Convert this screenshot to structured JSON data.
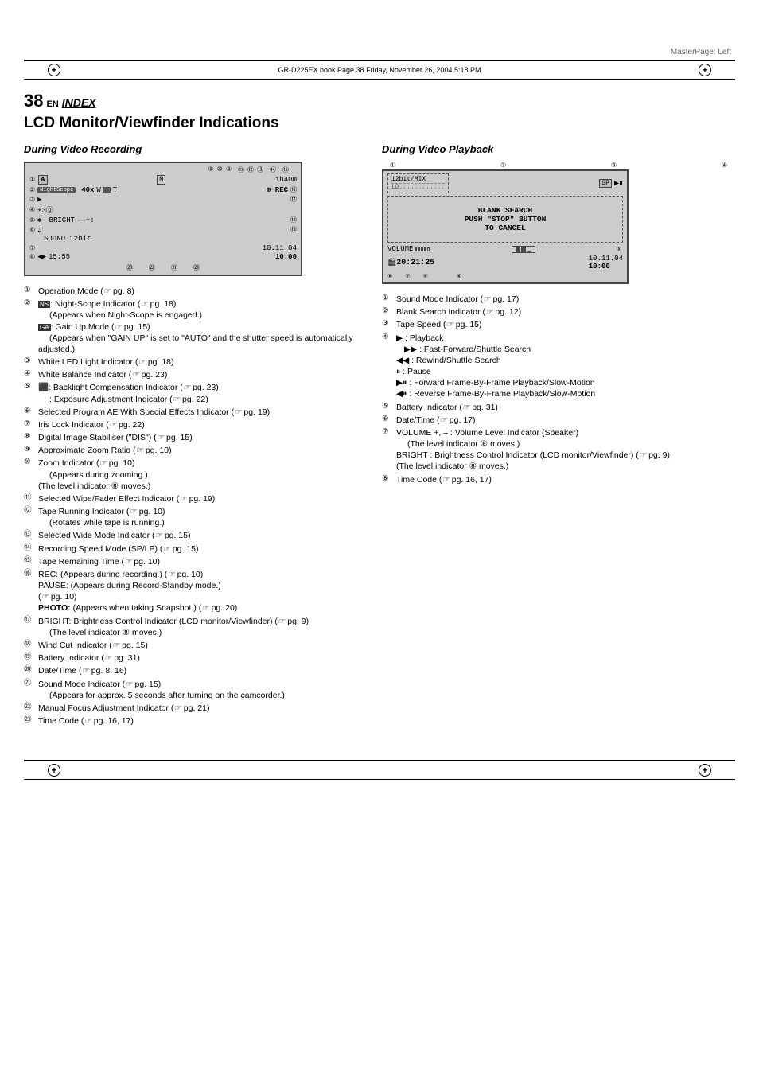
{
  "page": {
    "master_page_label": "MasterPage: Left",
    "book_ref": "GR-D225EX.book  Page 38  Friday, November 26, 2004  5:18 PM",
    "page_number": "38",
    "en_label": "EN",
    "index_label": "INDEX",
    "page_title": "LCD Monitor/Viewfinder Indications",
    "left_section_title": "During Video Recording",
    "right_section_title": "During Video Playback"
  },
  "recording_diagram": {
    "row1": "⑨ ⑩ ⑧  ⑪⑫⑬  ⑭  ⑮",
    "row2": "① A         M̈    1h40m",
    "row3": "②  40x W■■T",
    "row4": "③ ▶",
    "row5": "④ ±3⓪",
    "row6": "⑤ ✱         BRIGHT ——+:    ⑱",
    "row7": "⑥ 🎵                        ⑲",
    "row8": "    SOUND 12bit",
    "row9": "⑦                10.11.04",
    "row10": "⑧ ◀▶15:55         10:00",
    "row11": "         ⑳  ㉒ ㉑  ㉓"
  },
  "recording_items": [
    {
      "num": "①",
      "text": "Operation Mode (",
      "pg": "pg. 8",
      "suffix": ")"
    },
    {
      "num": "②",
      "text": ": Night-Scope Indicator (",
      "pg": "pg. 18",
      "suffix": ")",
      "extra": "(Appears when Night-Scope is engaged.)"
    },
    {
      "num": "",
      "text": ": Gain Up Mode (",
      "pg": "pg. 15",
      "suffix": ")",
      "extra": "(Appears when \"GAIN UP\" is set to \"AUTO\" and the shutter speed is automatically adjusted.)"
    },
    {
      "num": "③",
      "text": "White LED Light Indicator (",
      "pg": "pg. 18",
      "suffix": ")"
    },
    {
      "num": "④",
      "text": "White Balance Indicator (",
      "pg": "pg. 23",
      "suffix": ")"
    },
    {
      "num": "⑤",
      "text": ": Backlight Compensation Indicator (",
      "pg": "pg. 23",
      "suffix": ")"
    },
    {
      "num": "",
      "text": ": Exposure Adjustment Indicator (",
      "pg": "pg. 22",
      "suffix": ")"
    },
    {
      "num": "⑥",
      "text": "Selected Program AE With Special Effects Indicator (",
      "pg": "pg. 19",
      "suffix": ")"
    },
    {
      "num": "⑦",
      "text": "Iris Lock Indicator (",
      "pg": "pg. 22",
      "suffix": ")"
    },
    {
      "num": "⑧",
      "text": "Digital Image Stabiliser (\"DIS\") (",
      "pg": "pg. 15",
      "suffix": ")"
    },
    {
      "num": "⑨",
      "text": "Approximate Zoom Ratio (",
      "pg": "pg. 10",
      "suffix": ")"
    },
    {
      "num": "⑩",
      "text": "Zoom Indicator (",
      "pg": "pg. 10",
      "suffix": ")",
      "extra": "(Appears during zooming.)\n(The level indicator ⑧ moves.)"
    },
    {
      "num": "⑪",
      "text": "Selected Wipe/Fader Effect Indicator (",
      "pg": "pg. 19",
      "suffix": ")"
    },
    {
      "num": "⑫",
      "text": "Tape Running Indicator (",
      "pg": "pg. 10",
      "suffix": ")",
      "extra": "(Rotates while tape is running.)"
    },
    {
      "num": "⑬",
      "text": "Selected Wide Mode Indicator (",
      "pg": "pg. 15",
      "suffix": ")"
    },
    {
      "num": "⑭",
      "text": "Recording Speed Mode (SP/LP) (",
      "pg": "pg. 15",
      "suffix": ")"
    },
    {
      "num": "⑮",
      "text": "Tape Remaining Time (",
      "pg": "pg. 10",
      "suffix": ")"
    },
    {
      "num": "⑯",
      "text": "REC: (Appears during recording.) (",
      "pg": "pg. 10",
      "suffix": ")",
      "extra": "PAUSE: (Appears during Record-Standby mode.)\n(pg. 10)\nPHOTO: (Appears when taking Snapshot.) (pg. 20)"
    },
    {
      "num": "⑰",
      "text": "BRIGHT: Brightness Control Indicator (LCD monitor/Viewfinder) (",
      "pg": "pg. 9",
      "suffix": ")",
      "extra": "(The level indicator ⑧ moves.)"
    },
    {
      "num": "⑱",
      "text": "Wind Cut Indicator (",
      "pg": "pg. 15",
      "suffix": ")"
    },
    {
      "num": "⑲",
      "text": "Battery Indicator (",
      "pg": "pg. 31",
      "suffix": ")"
    },
    {
      "num": "⑳",
      "text": "Date/Time (",
      "pg": "pg. 8, 16",
      "suffix": ")"
    },
    {
      "num": "㉑",
      "text": "Sound Mode Indicator (",
      "pg": "pg. 15",
      "suffix": ")",
      "extra": "(Appears for approx. 5 seconds after turning on the camcorder.)"
    },
    {
      "num": "㉒",
      "text": "Manual Focus Adjustment Indicator (",
      "pg": "pg. 21",
      "suffix": ")"
    },
    {
      "num": "㉓",
      "text": "Time Code (",
      "pg": "pg. 16, 17",
      "suffix": ")"
    }
  ],
  "playback_items": [
    {
      "num": "①",
      "text": "Sound Mode Indicator (",
      "pg": "pg. 17",
      "suffix": ")"
    },
    {
      "num": "②",
      "text": "Blank Search Indicator (",
      "pg": "pg. 12",
      "suffix": ")"
    },
    {
      "num": "③",
      "text": "Tape Speed (",
      "pg": "pg. 15",
      "suffix": ")"
    },
    {
      "num": "④",
      "text": "▶ : Playback",
      "extra": "▶▶ : Fast-Forward/Shuttle Search\n◀◀ : Rewind/Shuttle Search\n⏸ : Pause\n▶⏸ : Forward Frame-By-Frame Playback/Slow-Motion\n◀⏸ : Reverse Frame-By-Frame Playback/Slow-Motion"
    },
    {
      "num": "⑤",
      "text": "Battery Indicator (",
      "pg": "pg. 31",
      "suffix": ")"
    },
    {
      "num": "⑥",
      "text": "Date/Time (",
      "pg": "pg. 17",
      "suffix": ")"
    },
    {
      "num": "⑦",
      "text": "VOLUME +, – : Volume Level Indicator (Speaker)",
      "extra": "(The level indicator ⑧ moves.)\nBRIGHT : Brightness Control Indicator (LCD monitor/Viewfinder) (pg. 9)\n(The level indicator ⑧ moves.)"
    },
    {
      "num": "⑧",
      "text": "Time Code (",
      "pg": "pg. 16, 17",
      "suffix": ")"
    }
  ],
  "icons": {
    "crosshair": "⊕",
    "arrow_right": "▶",
    "arrow_left": "◀",
    "pg_symbol": "☞"
  }
}
